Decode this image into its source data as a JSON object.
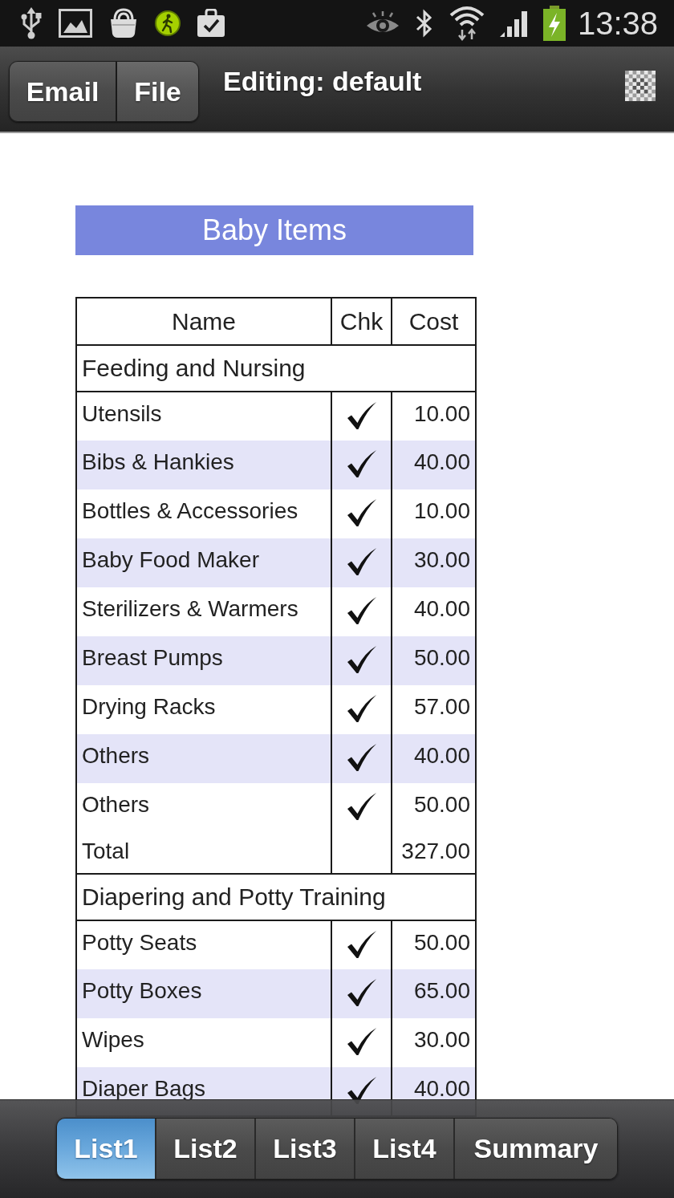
{
  "status_bar": {
    "time": "13:38"
  },
  "action_bar": {
    "buttons": [
      {
        "label": "Email"
      },
      {
        "label": "File"
      }
    ],
    "title": "Editing: default"
  },
  "list": {
    "title": "Baby Items",
    "columns": [
      "Name",
      "Chk",
      "Cost"
    ],
    "sections": [
      {
        "title": "Feeding and Nursing",
        "rows": [
          {
            "name": "Utensils",
            "checked": true,
            "cost": "10.00"
          },
          {
            "name": "Bibs & Hankies",
            "checked": true,
            "cost": "40.00"
          },
          {
            "name": "Bottles & Accessories",
            "checked": true,
            "cost": "10.00"
          },
          {
            "name": "Baby Food Maker",
            "checked": true,
            "cost": "30.00"
          },
          {
            "name": "Sterilizers & Warmers",
            "checked": true,
            "cost": "40.00"
          },
          {
            "name": "Breast Pumps",
            "checked": true,
            "cost": "50.00"
          },
          {
            "name": "Drying Racks",
            "checked": true,
            "cost": "57.00"
          },
          {
            "name": "Others",
            "checked": true,
            "cost": "40.00"
          },
          {
            "name": "Others",
            "checked": true,
            "cost": "50.00"
          }
        ],
        "total": {
          "label": "Total",
          "cost": "327.00"
        }
      },
      {
        "title": "Diapering and Potty Training",
        "rows": [
          {
            "name": "Potty Seats",
            "checked": true,
            "cost": "50.00"
          },
          {
            "name": "Potty Boxes",
            "checked": true,
            "cost": "65.00"
          },
          {
            "name": "Wipes",
            "checked": true,
            "cost": "30.00"
          },
          {
            "name": "Diaper Bags",
            "checked": true,
            "cost": "40.00"
          }
        ]
      }
    ]
  },
  "tabs": [
    {
      "label": "List1",
      "selected": true
    },
    {
      "label": "List2",
      "selected": false
    },
    {
      "label": "List3",
      "selected": false
    },
    {
      "label": "List4",
      "selected": false
    },
    {
      "label": "Summary",
      "selected": false
    }
  ]
}
